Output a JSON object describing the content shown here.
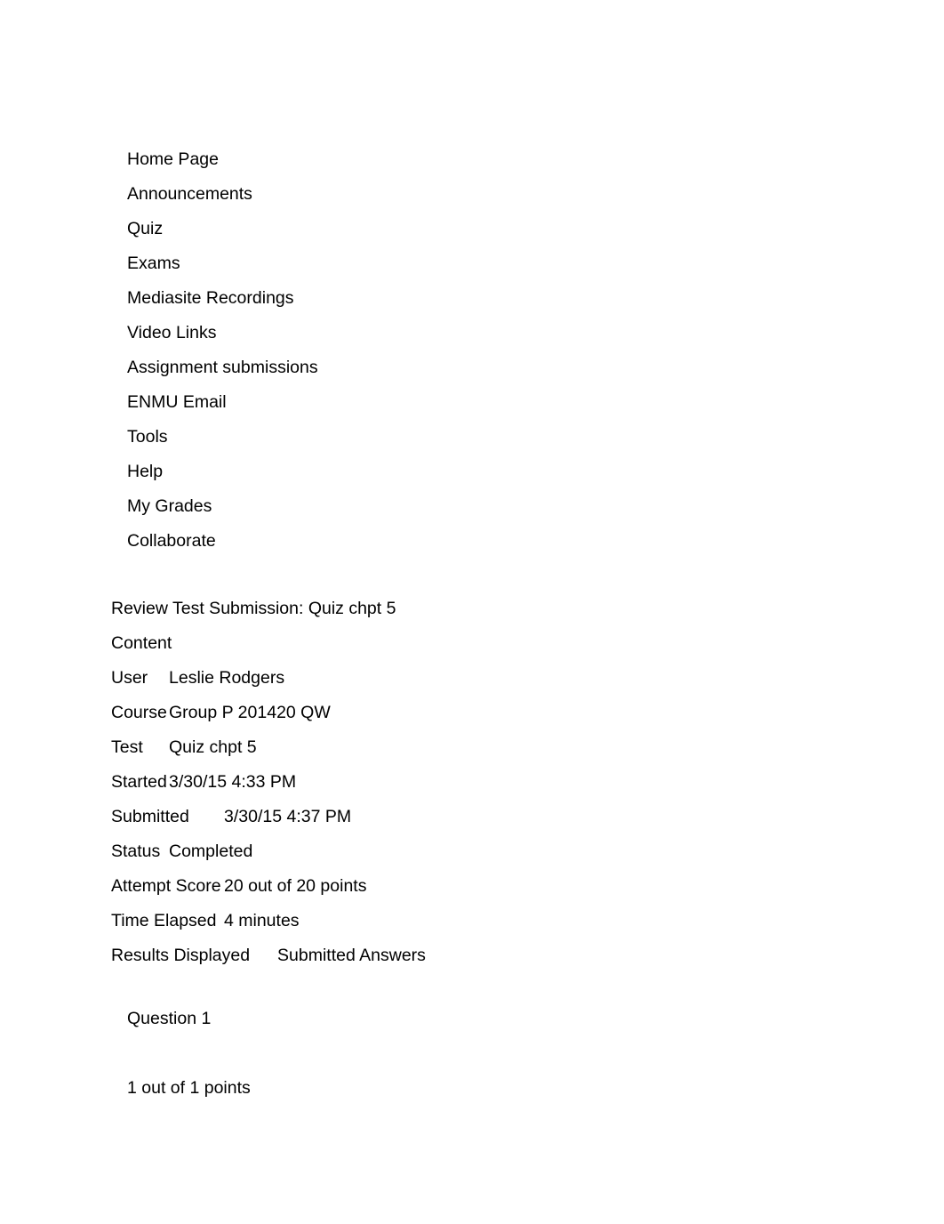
{
  "course_menu": {
    "items": [
      {
        "label": "Home Page"
      },
      {
        "label": "Announcements"
      },
      {
        "label": "Quiz"
      },
      {
        "label": "Exams"
      },
      {
        "label": "Mediasite Recordings"
      },
      {
        "label": "Video Links"
      },
      {
        "label": "Assignment submissions"
      },
      {
        "label": "ENMU Email"
      },
      {
        "label": "Tools"
      },
      {
        "label": "Help"
      },
      {
        "label": "My Grades"
      },
      {
        "label": "Collaborate"
      }
    ]
  },
  "review": {
    "title": "Review Test Submission: Quiz chpt 5",
    "content_heading": "Content",
    "rows": [
      {
        "label": "User",
        "value": "Leslie Rodgers",
        "tab": 1
      },
      {
        "label": "Course",
        "value": "Group P 201420 QW",
        "tab": 1
      },
      {
        "label": "Test",
        "value": "Quiz chpt 5",
        "tab": 1
      },
      {
        "label": "Started",
        "value": "3/30/15 4:33 PM",
        "tab": 1
      },
      {
        "label": "Submitted",
        "value": "3/30/15 4:37 PM",
        "tab": 2
      },
      {
        "label": "Status",
        "value": "Completed",
        "tab": 1
      },
      {
        "label": "Attempt Score",
        "value": "20 out of 20 points",
        "tab": 2
      },
      {
        "label": "Time Elapsed",
        "value": "4 minutes",
        "tab": 2
      },
      {
        "label": "Results Displayed",
        "value": "Submitted Answers",
        "tab": 3
      }
    ]
  },
  "question": {
    "title": "Question 1",
    "points": "1 out of 1 points"
  },
  "colors": {
    "page_background": "#ffffff",
    "text": "#000000"
  }
}
